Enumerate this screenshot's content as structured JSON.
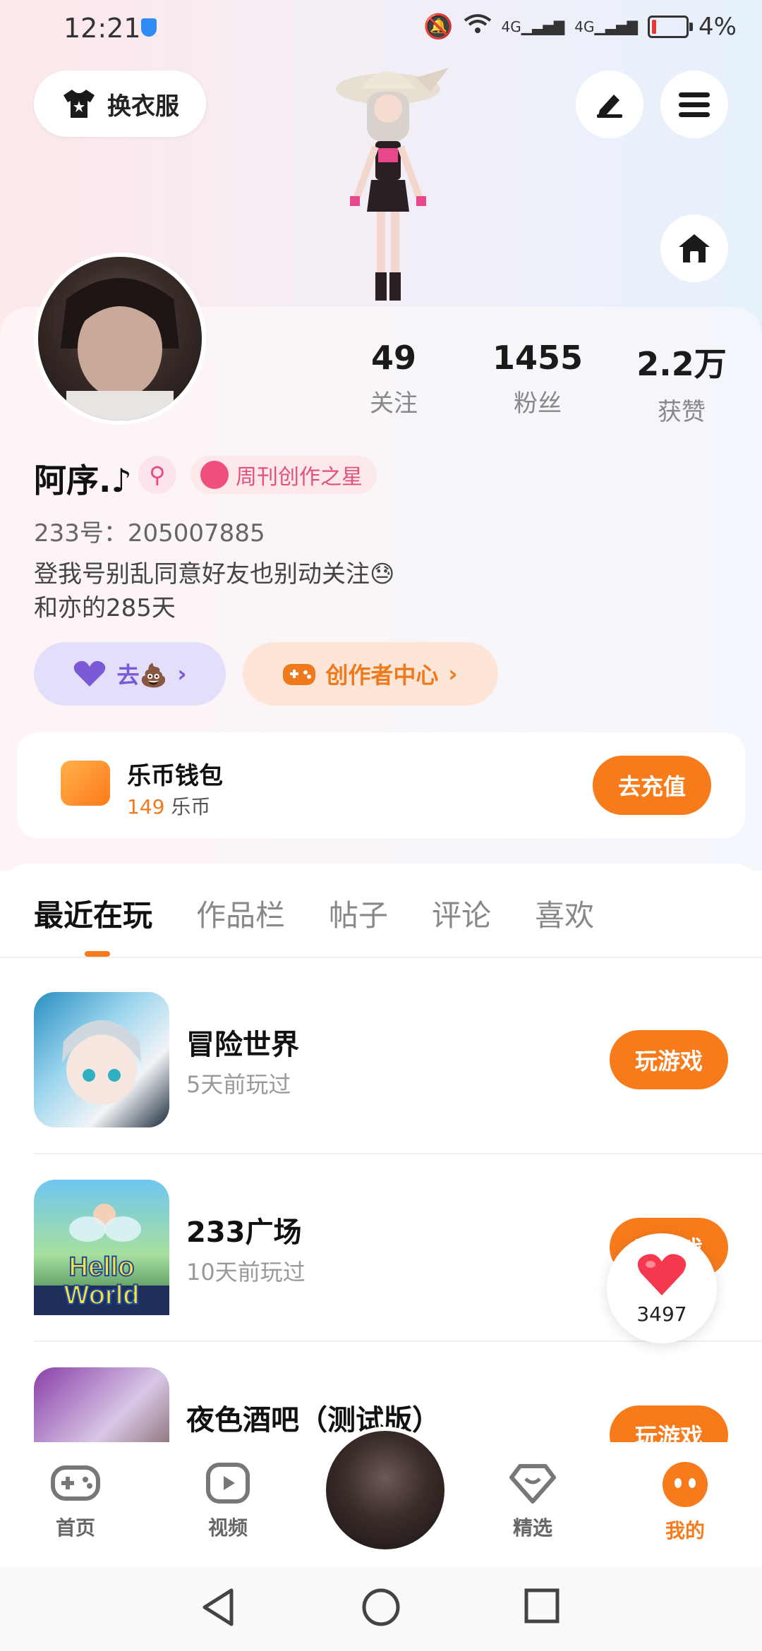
{
  "status_bar": {
    "time": "12:21",
    "battery": "4%",
    "network": "4G"
  },
  "header": {
    "dress_label": "换衣服",
    "icons": {
      "edit": "edit-pen-icon",
      "menu": "menu-lines-icon",
      "home": "home-icon"
    }
  },
  "profile": {
    "stats": [
      {
        "value": "49",
        "label": "关注"
      },
      {
        "value": "1455",
        "label": "粉丝"
      },
      {
        "value": "2.2万",
        "label": "获赞"
      }
    ],
    "name": "阿序.♪",
    "gender_symbol": "⚲",
    "badge": "周刊创作之星",
    "uid": "233号：205007885",
    "bio_line1": "登我号别乱同意好友也别动关注😓",
    "bio_line2": "和亦的285天",
    "fancy_button": "去💩",
    "creator_button": "创作者中心"
  },
  "wallet": {
    "title": "乐币钱包",
    "amount": "149",
    "unit": "乐币",
    "recharge": "去充值"
  },
  "tabs": [
    {
      "label": "最近在玩",
      "active": true
    },
    {
      "label": "作品栏"
    },
    {
      "label": "帖子"
    },
    {
      "label": "评论"
    },
    {
      "label": "喜欢"
    }
  ],
  "games": [
    {
      "name": "冒险世界",
      "time": "5天前玩过",
      "action": "玩游戏"
    },
    {
      "name": "233广场",
      "time": "10天前玩过",
      "action": "玩游戏"
    },
    {
      "name": "夜色酒吧（测试版）",
      "time": "",
      "action": "玩游戏"
    }
  ],
  "floating_like": {
    "count": "3497"
  },
  "bottom_nav": [
    {
      "label": "首页",
      "icon": "gamepad-icon"
    },
    {
      "label": "视频",
      "icon": "video-icon"
    },
    {
      "label": "精选",
      "icon": "heart-shield-icon"
    },
    {
      "label": "我的",
      "icon": "face-icon",
      "active": true
    }
  ],
  "colors": {
    "accent": "#f77b1b",
    "purple": "#7b5ad8",
    "pink": "#e0527b"
  }
}
